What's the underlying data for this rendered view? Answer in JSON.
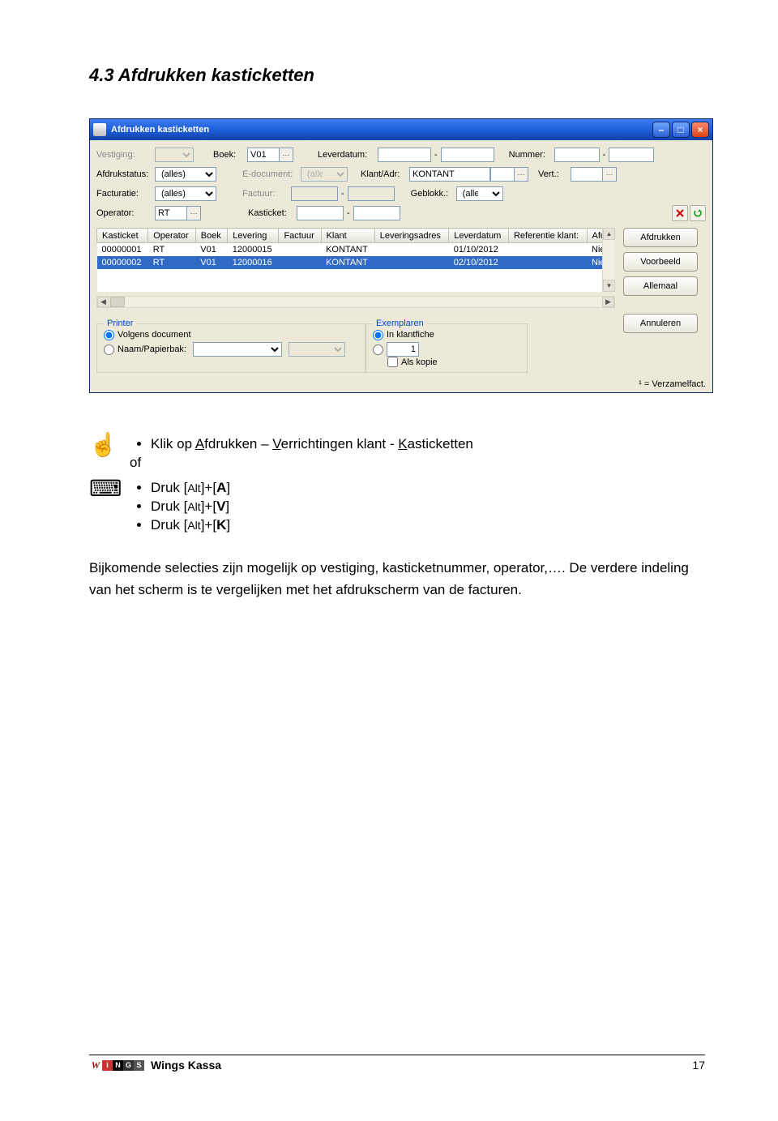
{
  "heading": "4.3  Afdrukken kasticketten",
  "window": {
    "title": "Afdrukken kasticketten",
    "labels": {
      "vestiging": "Vestiging:",
      "boek": "Boek:",
      "leverdatum": "Leverdatum:",
      "nummer": "Nummer:",
      "afdrukstatus": "Afdrukstatus:",
      "edoc": "E-document:",
      "klantadr": "Klant/Adr:",
      "vert": "Vert.:",
      "facturatie": "Facturatie:",
      "factuur": "Factuur:",
      "geblokk": "Geblokk.:",
      "operator": "Operator:",
      "kasticket": "Kasticket:"
    },
    "values": {
      "boek": "V01",
      "afdrukstatus": "(alles)",
      "edoc": "(alles)",
      "klantadr": "KONTANT",
      "facturatie": "(alles)",
      "geblokk": "(alles)",
      "operator": "RT"
    },
    "columns": [
      "Kasticket",
      "Operator",
      "Boek",
      "Levering",
      "Factuur",
      "Klant",
      "Leveringsadres",
      "Leverdatum",
      "Referentie klant:",
      "Afdr"
    ],
    "rows": [
      {
        "kasticket": "00000001",
        "operator": "RT",
        "boek": "V01",
        "levering": "12000015",
        "factuur": "",
        "klant": "KONTANT",
        "leveringsadres": "",
        "leverdatum": "01/10/2012",
        "ref": "",
        "afdr": "Niet"
      },
      {
        "kasticket": "00000002",
        "operator": "RT",
        "boek": "V01",
        "levering": "12000016",
        "factuur": "",
        "klant": "KONTANT",
        "leveringsadres": "",
        "leverdatum": "02/10/2012",
        "ref": "",
        "afdr": "Niet"
      }
    ],
    "buttons": {
      "afdrukken": "Afdrukken",
      "voorbeeld": "Voorbeeld",
      "allemaal": "Allemaal",
      "annuleren": "Annuleren"
    },
    "printer": {
      "legend": "Printer",
      "volgens": "Volgens document",
      "naam": "Naam/Papierbak:"
    },
    "exemplaren": {
      "legend": "Exemplaren",
      "inklantfiche": "In klantfiche",
      "count": "1",
      "alskopie": "Als kopie"
    },
    "footnote": "¹ = Verzamelfact."
  },
  "instructions": {
    "mouse": {
      "text_pre": "Klik op ",
      "a": "A",
      "a_rest": "fdrukken – ",
      "v": "V",
      "v_rest": "errichtingen klant - ",
      "k": "K",
      "k_rest": "asticketten"
    },
    "of": "of",
    "kb": {
      "line1_pre": "Druk [",
      "line1_alt": "Alt",
      "line1_mid": "]+[",
      "line1_key": "A",
      "line1_end": "]",
      "line2_pre": "Druk [",
      "line2_alt": "Alt",
      "line2_mid": "]+[",
      "line2_key": "V",
      "line2_end": "]",
      "line3_pre": "Druk [",
      "line3_alt": "Alt",
      "line3_mid": "]+[",
      "line3_key": "K",
      "line3_end": "]"
    }
  },
  "body_text": "Bijkomende selecties zijn mogelijk op vestiging, kasticketnummer, operator,….  De verdere indeling van het scherm is te vergelijken met het afdrukscherm van de facturen.",
  "footer": {
    "title": "Wings Kassa",
    "page": "17"
  }
}
